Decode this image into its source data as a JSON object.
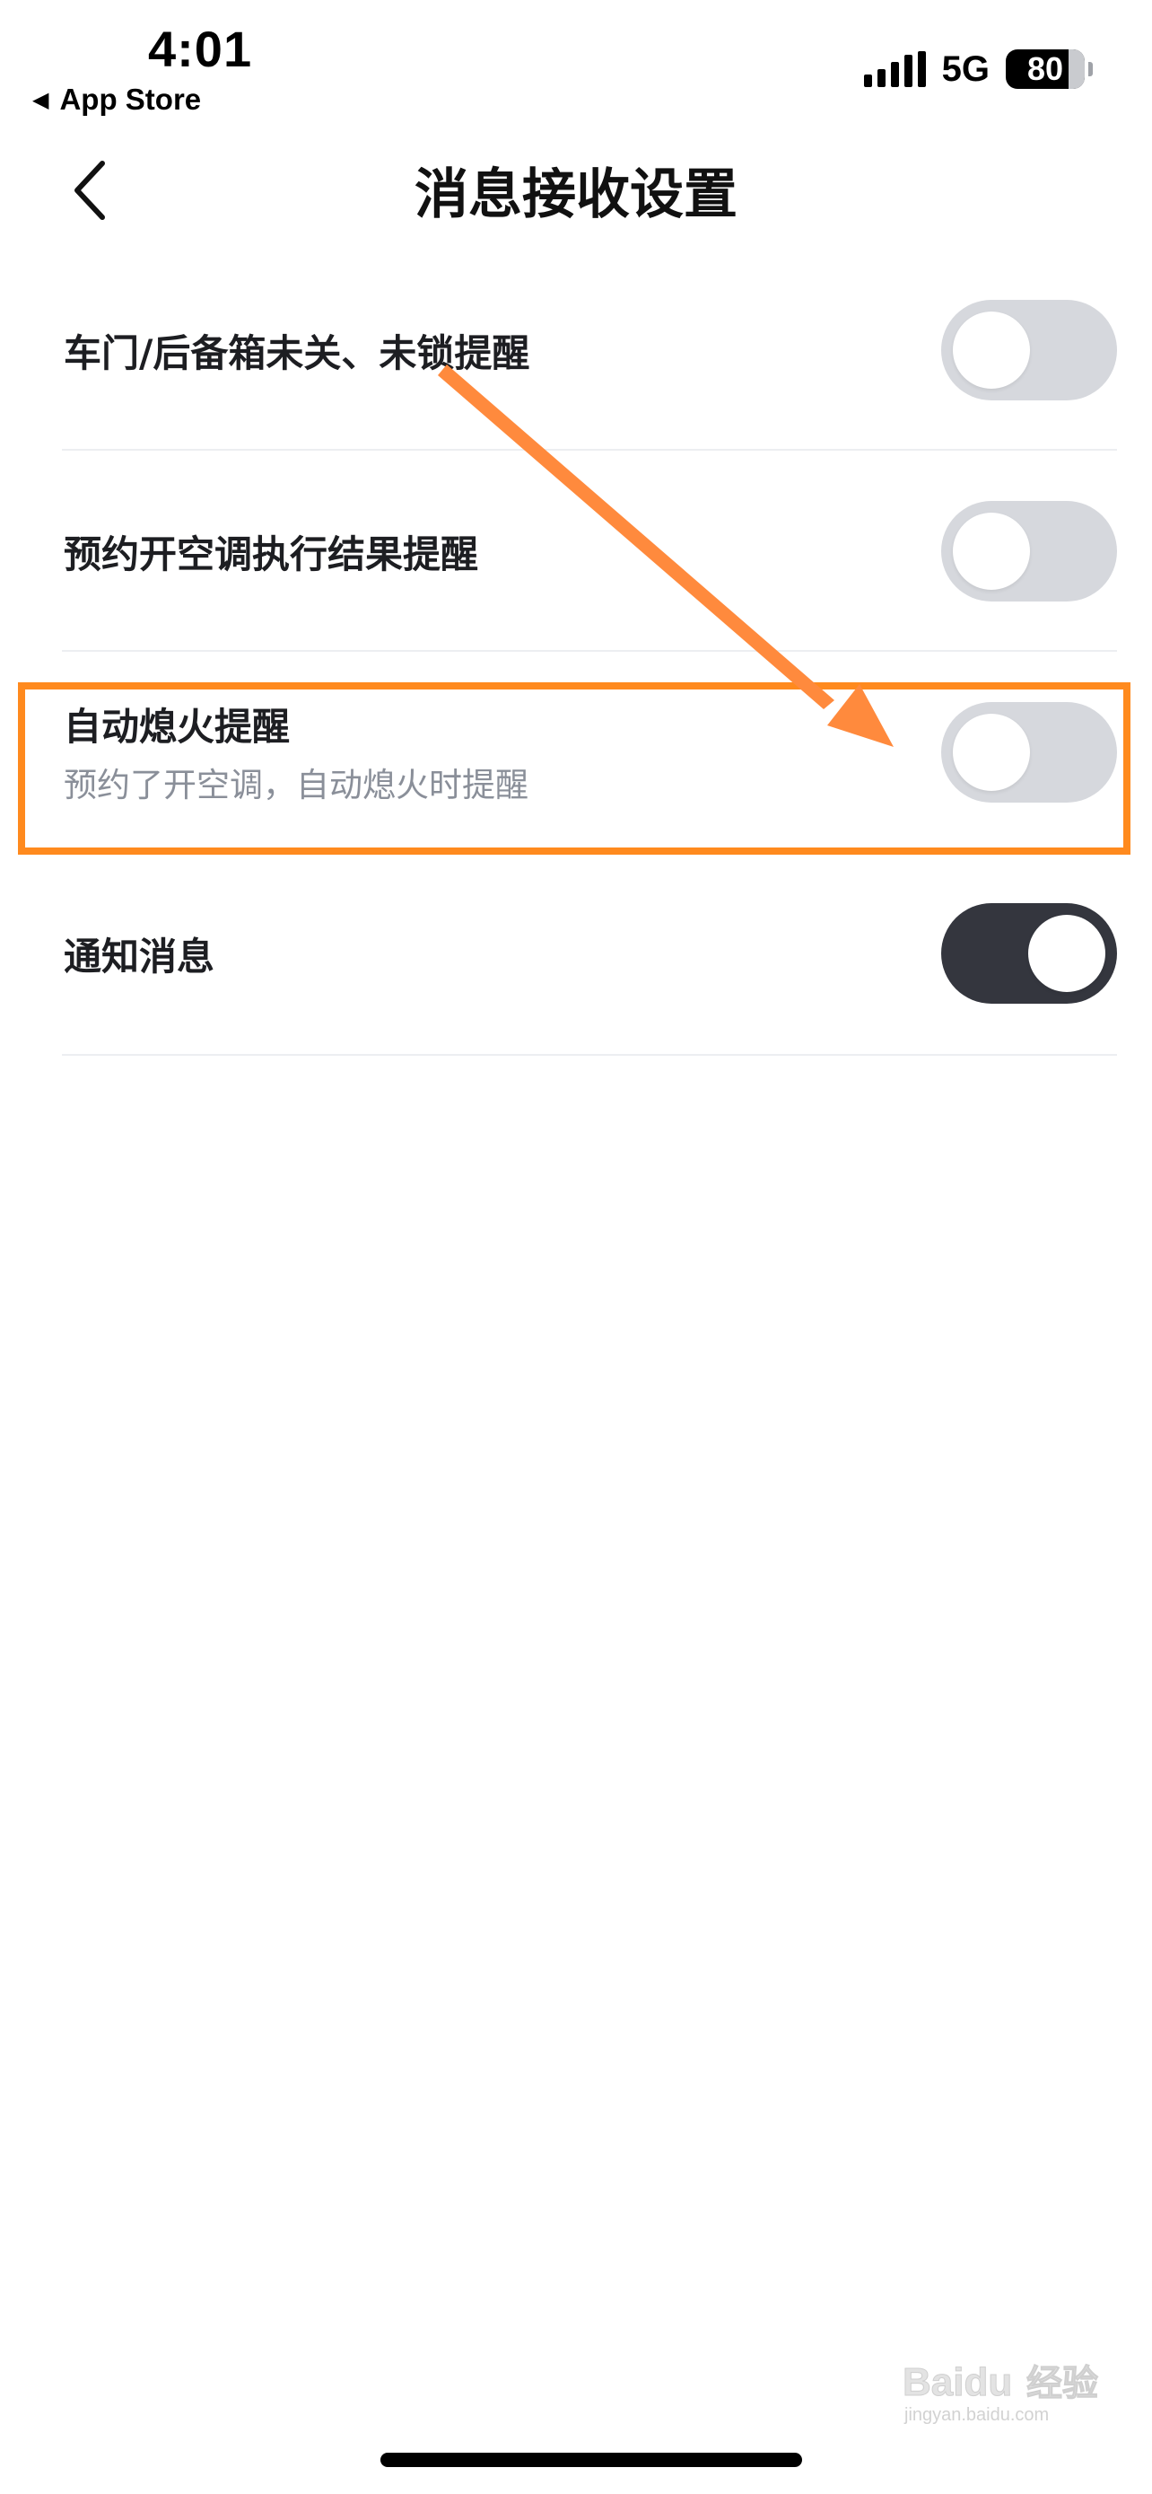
{
  "status_bar": {
    "time": "4:01",
    "back_to_app": "App Store",
    "back_arrow_icon": "triangle-left-icon",
    "network": "5G",
    "battery": "80",
    "battery_level": 0.8
  },
  "nav": {
    "title": "消息接收设置",
    "back_icon": "chevron-left-icon"
  },
  "settings": [
    {
      "label": "车门/后备箱未关、未锁提醒",
      "enabled": false
    },
    {
      "label": "预约开空调执行结果提醒",
      "enabled": false
    },
    {
      "label": "自动熄火提醒",
      "sublabel": "预约了开空调，自动熄火时提醒",
      "enabled": false
    },
    {
      "label": "通知消息",
      "enabled": true
    }
  ],
  "annotation": {
    "arrow_color": "#ff8a3d",
    "box_color": "#ff8a1e"
  },
  "colors": {
    "toggle_off": "#d6d8dd",
    "toggle_on": "#34363e",
    "divider": "#eceef1"
  },
  "watermark": {
    "brand": "Baidu",
    "text": "经验",
    "url": "jingyan.baidu.com"
  }
}
